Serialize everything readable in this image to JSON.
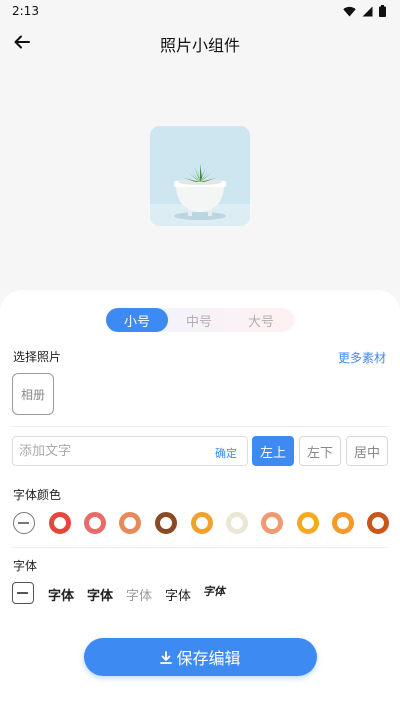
{
  "status": {
    "time": "2:13"
  },
  "header": {
    "title": "照片小组件"
  },
  "size_tabs": [
    {
      "label": "小号",
      "active": true
    },
    {
      "label": "中号",
      "active": false
    },
    {
      "label": "大号",
      "active": false
    }
  ],
  "photo": {
    "section_label": "选择照片",
    "more_link": "更多素材",
    "album_label": "相册"
  },
  "text": {
    "placeholder": "添加文字",
    "confirm_label": "确定"
  },
  "position": {
    "top_left": "左上",
    "bottom_left": "左下",
    "center": "居中"
  },
  "font_color": {
    "label": "字体颜色",
    "swatches": [
      "#e8453c",
      "#e86a6a",
      "#e8895a",
      "#8b4a26",
      "#f0a22e",
      "#ece6d4",
      "#ee9a72",
      "#f3ab1c",
      "#f29a2a",
      "#c9561a"
    ]
  },
  "font": {
    "label": "字体",
    "samples": [
      "字体",
      "字体",
      "字体",
      "字体",
      "字体"
    ]
  },
  "save": {
    "label": "保存编辑"
  },
  "colors": {
    "accent": "#3d8bf2"
  }
}
